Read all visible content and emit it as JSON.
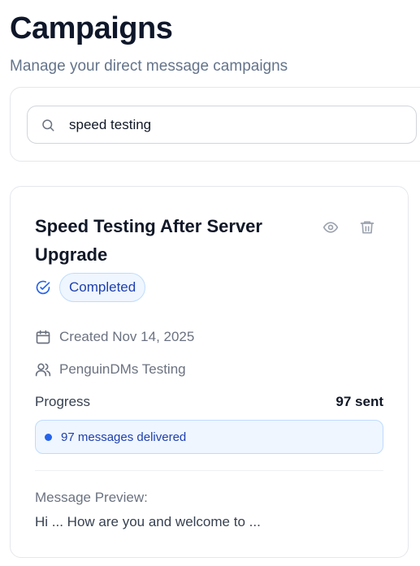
{
  "header": {
    "title": "Campaigns",
    "subtitle": "Manage your direct message campaigns"
  },
  "search": {
    "value": "speed testing",
    "icon": "search-icon"
  },
  "campaign": {
    "title": "Speed Testing After Server Upgrade",
    "status": "Completed",
    "created": "Created Nov 14, 2025",
    "owner": "PenguinDMs Testing",
    "progress_label": "Progress",
    "progress_value": "97 sent",
    "delivered_text": "97 messages delivered",
    "preview_label": "Message Preview:",
    "preview_text": "Hi ... How are you and welcome to ..."
  },
  "colors": {
    "accent": "#2563eb",
    "badge_bg": "#eff6ff",
    "badge_border": "#bfdbfe",
    "badge_text": "#1e40af",
    "muted": "#6b7280"
  }
}
